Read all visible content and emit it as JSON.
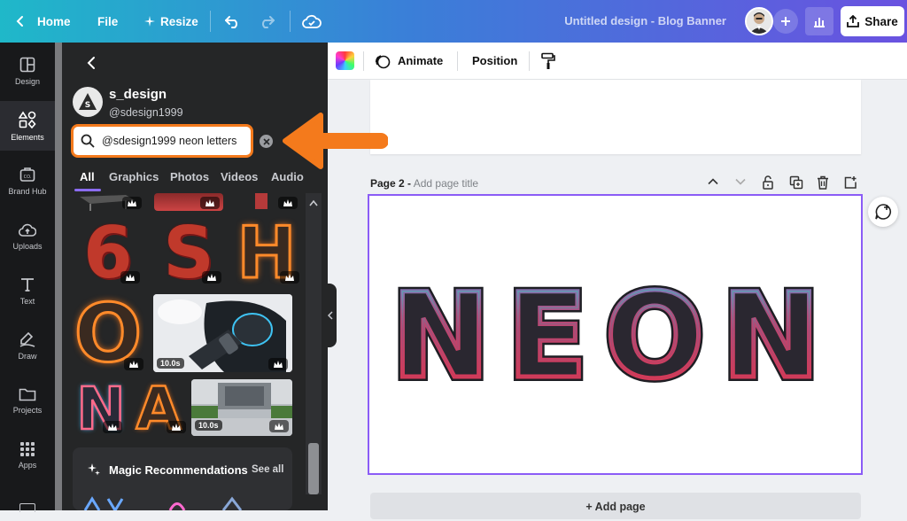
{
  "topbar": {
    "home_label": "Home",
    "file_label": "File",
    "resize_label": "Resize",
    "doc_title": "Untitled design - Blog Banner",
    "share_label": "Share"
  },
  "rail": {
    "items": [
      {
        "label": "Design",
        "icon": "layout-icon"
      },
      {
        "label": "Elements",
        "icon": "shapes-icon"
      },
      {
        "label": "Brand Hub",
        "icon": "brand-icon"
      },
      {
        "label": "Uploads",
        "icon": "upload-icon"
      },
      {
        "label": "Text",
        "icon": "text-icon"
      },
      {
        "label": "Draw",
        "icon": "draw-icon"
      },
      {
        "label": "Projects",
        "icon": "folder-icon"
      },
      {
        "label": "Apps",
        "icon": "apps-icon"
      }
    ]
  },
  "panel": {
    "account_name": "s_design",
    "account_handle": "@sdesign1999",
    "search_value": "@sdesign1999 neon letters",
    "tabs": [
      "All",
      "Graphics",
      "Photos",
      "Videos",
      "Audio"
    ],
    "tiles": {
      "letters_row1": [
        "6",
        "S",
        "H"
      ],
      "letter_o": "O",
      "letters_row3": [
        "N",
        "A"
      ],
      "video1_duration": "10.0s",
      "video2_duration": "10.0s"
    },
    "magic_label": "Magic Recommendations",
    "see_all_label": "See all"
  },
  "toolbar": {
    "animate_label": "Animate",
    "position_label": "Position"
  },
  "canvas": {
    "page2_prefix": "Page 2 -",
    "page2_title_placeholder": "Add page title",
    "design_text": "NEON",
    "add_page_label": "+ Add page"
  },
  "colors": {
    "accent": "#8b5cf6",
    "highlight": "#f47a1c"
  }
}
